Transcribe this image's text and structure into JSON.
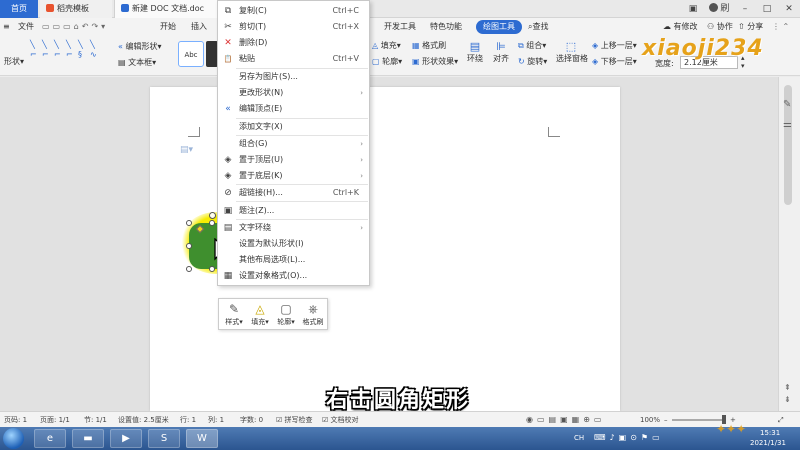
{
  "titlebar": {
    "tabs": [
      {
        "label": "首页"
      },
      {
        "label": "稻壳模板"
      },
      {
        "label": "新建 DOC 文档.doc"
      }
    ],
    "right": {
      "avatar_name": "刷"
    }
  },
  "menu": {
    "file": "文件",
    "items": [
      "开始",
      "插入"
    ],
    "tabs_right": [
      "开发工具",
      "特色功能",
      "绘图工具"
    ],
    "search": "查找",
    "has_changes": "有修改",
    "collab": "协作",
    "share": "分享"
  },
  "toolbar": {
    "shape_label": "形状",
    "edit_shape": "编辑形状",
    "text_box": "文本框",
    "style_sample": "Abc",
    "fill": "填充",
    "outline": "轮廓",
    "format_painter": "格式刷",
    "shape_effects": "形状效果",
    "wrap": "环绕",
    "align": "对齐",
    "group": "组合",
    "rotate": "旋转",
    "selection_pane": "选择窗格",
    "bring_forward": "上移一层",
    "send_backward": "下移一层",
    "width_label": "宽度:",
    "width_value": "2.12厘米"
  },
  "context_menu": {
    "items": [
      {
        "icon": "copy-icon",
        "glyph": "⧉",
        "label": "复制(C)",
        "shortcut": "Ctrl+C"
      },
      {
        "icon": "cut-icon",
        "glyph": "✂",
        "label": "剪切(T)",
        "shortcut": "Ctrl+X"
      },
      {
        "icon": "delete-icon",
        "glyph": "✕",
        "label": "删除(D)",
        "shortcut": ""
      },
      {
        "icon": "paste-icon",
        "glyph": "📋",
        "label": "粘贴",
        "shortcut": "Ctrl+V"
      },
      {
        "icon": "",
        "glyph": "",
        "label": "另存为图片(S)...",
        "shortcut": ""
      },
      {
        "icon": "",
        "glyph": "",
        "label": "更改形状(N)",
        "shortcut": "",
        "submenu": true
      },
      {
        "icon": "edit-points-icon",
        "glyph": "«",
        "label": "编辑顶点(E)",
        "shortcut": ""
      },
      {
        "icon": "",
        "glyph": "",
        "label": "添加文字(X)",
        "shortcut": ""
      },
      {
        "icon": "",
        "glyph": "",
        "label": "组合(G)",
        "shortcut": "",
        "submenu": true
      },
      {
        "icon": "bring-to-front-icon",
        "glyph": "◈",
        "label": "置于顶层(U)",
        "shortcut": "",
        "submenu": true
      },
      {
        "icon": "send-to-back-icon",
        "glyph": "◈",
        "label": "置于底层(K)",
        "shortcut": "",
        "submenu": true
      },
      {
        "icon": "hyperlink-icon",
        "glyph": "⊘",
        "label": "超链接(H)...",
        "shortcut": "Ctrl+K"
      },
      {
        "icon": "caption-icon",
        "glyph": "▣",
        "label": "题注(Z)...",
        "shortcut": ""
      },
      {
        "icon": "text-wrap-icon",
        "glyph": "▤",
        "label": "文字环绕",
        "shortcut": "",
        "submenu": true
      },
      {
        "icon": "",
        "glyph": "",
        "label": "设置为默认形状(I)",
        "shortcut": ""
      },
      {
        "icon": "",
        "glyph": "",
        "label": "其他布局选项(L)...",
        "shortcut": ""
      },
      {
        "icon": "format-object-icon",
        "glyph": "▦",
        "label": "设置对象格式(O)...",
        "shortcut": ""
      }
    ]
  },
  "mini_toolbar": {
    "items": [
      {
        "icon": "style-brush-icon",
        "glyph": "✎",
        "label": "样式"
      },
      {
        "icon": "fill-bucket-icon",
        "glyph": "◬",
        "label": "填充"
      },
      {
        "icon": "outline-icon",
        "glyph": "▢",
        "label": "轮廓"
      },
      {
        "icon": "format-painter-icon",
        "glyph": "⎈",
        "label": "格式刷"
      }
    ]
  },
  "caption": "右击圆角矩形",
  "statusbar": {
    "page_num": "页码: 1",
    "pages": "页面: 1/1",
    "section": "节: 1/1",
    "position": "设置值: 2.5厘米",
    "line": "行: 1",
    "column": "列: 1",
    "word_count": "字数: 0",
    "spell_check": "拼写检查",
    "doc_proof": "文档校对",
    "zoom": "100%"
  },
  "taskbar": {
    "ime": "CH",
    "time": "15:31",
    "date": "2021/1/31"
  },
  "watermark": "xiaoji234",
  "colors": {
    "accent": "#2d6bd1",
    "shape_fill": "#3f8f2e",
    "highlight": "#f6ec00",
    "watermark": "#e6a21a"
  }
}
